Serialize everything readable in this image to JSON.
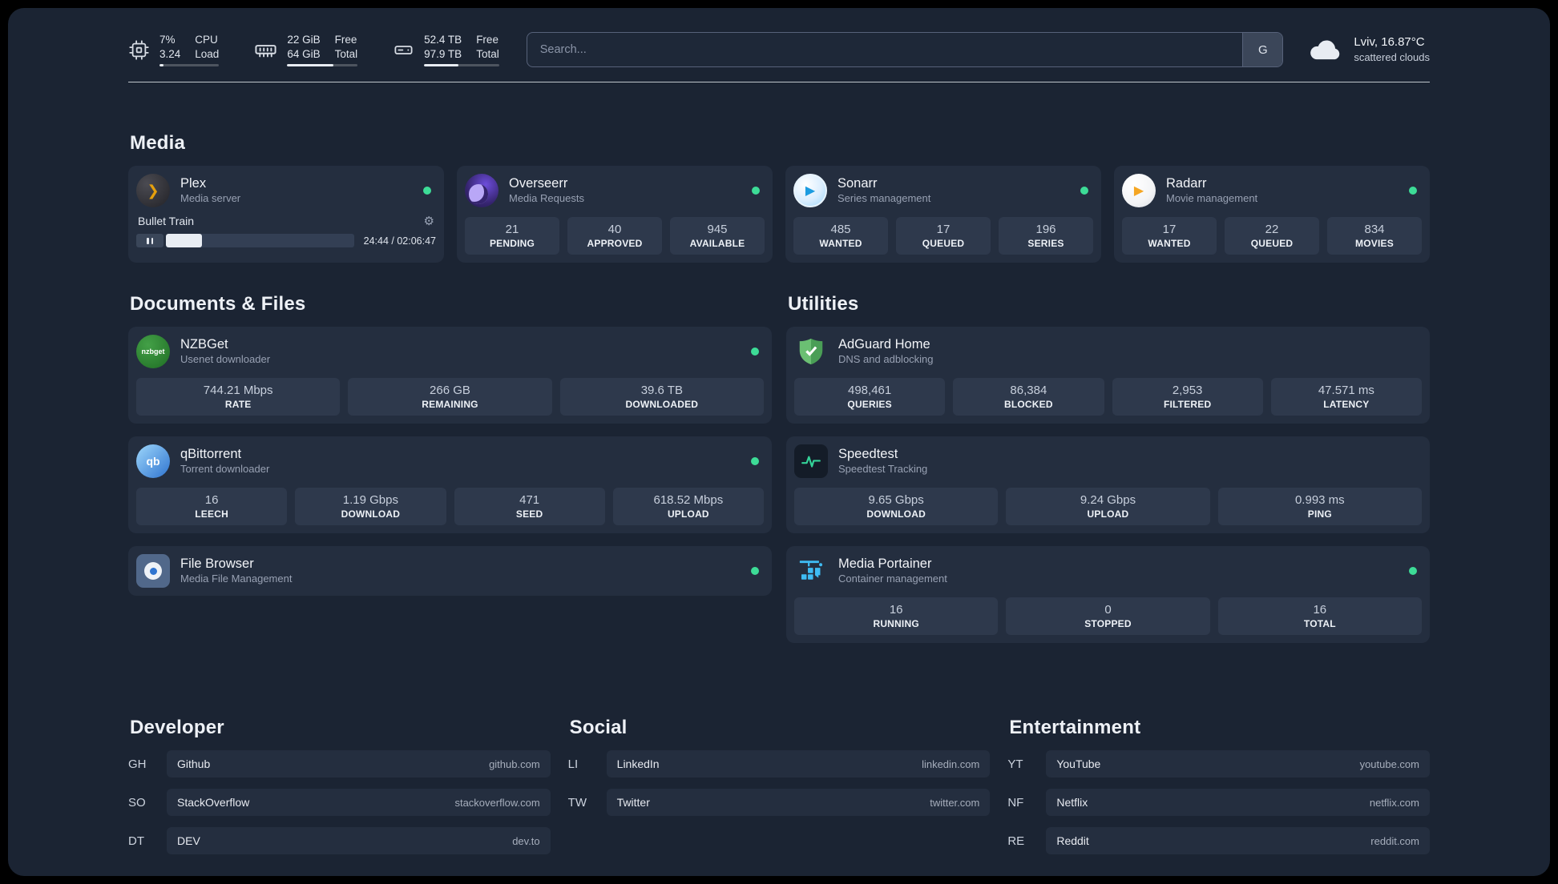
{
  "colors": {
    "page_bg": "#1b2433",
    "card_bg": "#242e3f",
    "tile_bg": "#2e394c",
    "status_green": "#3ddc97"
  },
  "icons": {
    "gear": "⚙",
    "plex_glyph": "❯",
    "sonarr_glyph": "▶",
    "radarr_glyph": "▶",
    "qbittorrent_glyph": "qb",
    "nzbget_text": "nzbget"
  },
  "topbar": {
    "resources": [
      {
        "rows": [
          {
            "value": "7%",
            "label": "CPU"
          },
          {
            "value": "3.24",
            "label": "Load"
          }
        ],
        "progress": 7
      },
      {
        "rows": [
          {
            "value": "22 GiB",
            "label": "Free"
          },
          {
            "value": "64 GiB",
            "label": "Total"
          }
        ],
        "progress": 66
      },
      {
        "rows": [
          {
            "value": "52.4 TB",
            "label": "Free"
          },
          {
            "value": "97.9 TB",
            "label": "Total"
          }
        ],
        "progress": 46
      }
    ],
    "search": {
      "placeholder": "Search...",
      "button_label": "G"
    },
    "weather": {
      "location": "Lviv, 16.87°C",
      "condition": "scattered clouds"
    }
  },
  "sections": {
    "media": "Media",
    "documents": "Documents & Files",
    "utilities": "Utilities",
    "developer": "Developer",
    "social": "Social",
    "entertainment": "Entertainment"
  },
  "services": {
    "plex": {
      "name": "Plex",
      "subtitle": "Media server",
      "player": {
        "track": "Bullet Train",
        "time": "24:44 / 02:06:47",
        "progress": 19
      }
    },
    "overseerr": {
      "name": "Overseerr",
      "subtitle": "Media Requests",
      "stats": [
        {
          "value": "21",
          "label": "PENDING"
        },
        {
          "value": "40",
          "label": "APPROVED"
        },
        {
          "value": "945",
          "label": "AVAILABLE"
        }
      ]
    },
    "sonarr": {
      "name": "Sonarr",
      "subtitle": "Series management",
      "stats": [
        {
          "value": "485",
          "label": "WANTED"
        },
        {
          "value": "17",
          "label": "QUEUED"
        },
        {
          "value": "196",
          "label": "SERIES"
        }
      ]
    },
    "radarr": {
      "name": "Radarr",
      "subtitle": "Movie management",
      "stats": [
        {
          "value": "17",
          "label": "WANTED"
        },
        {
          "value": "22",
          "label": "QUEUED"
        },
        {
          "value": "834",
          "label": "MOVIES"
        }
      ]
    },
    "nzbget": {
      "name": "NZBGet",
      "subtitle": "Usenet downloader",
      "stats": [
        {
          "value": "744.21 Mbps",
          "label": "RATE"
        },
        {
          "value": "266 GB",
          "label": "REMAINING"
        },
        {
          "value": "39.6 TB",
          "label": "DOWNLOADED"
        }
      ]
    },
    "qbittorrent": {
      "name": "qBittorrent",
      "subtitle": "Torrent downloader",
      "stats": [
        {
          "value": "16",
          "label": "LEECH"
        },
        {
          "value": "1.19 Gbps",
          "label": "DOWNLOAD"
        },
        {
          "value": "471",
          "label": "SEED"
        },
        {
          "value": "618.52 Mbps",
          "label": "UPLOAD"
        }
      ]
    },
    "filebrowser": {
      "name": "File Browser",
      "subtitle": "Media File Management"
    },
    "adguard": {
      "name": "AdGuard Home",
      "subtitle": "DNS and adblocking",
      "stats": [
        {
          "value": "498,461",
          "label": "QUERIES"
        },
        {
          "value": "86,384",
          "label": "BLOCKED"
        },
        {
          "value": "2,953",
          "label": "FILTERED"
        },
        {
          "value": "47.571 ms",
          "label": "LATENCY"
        }
      ]
    },
    "speedtest": {
      "name": "Speedtest",
      "subtitle": "Speedtest Tracking",
      "stats": [
        {
          "value": "9.65 Gbps",
          "label": "DOWNLOAD"
        },
        {
          "value": "9.24 Gbps",
          "label": "UPLOAD"
        },
        {
          "value": "0.993 ms",
          "label": "PING"
        }
      ]
    },
    "portainer": {
      "name": "Media Portainer",
      "subtitle": "Container management",
      "stats": [
        {
          "value": "16",
          "label": "RUNNING"
        },
        {
          "value": "0",
          "label": "STOPPED"
        },
        {
          "value": "16",
          "label": "TOTAL"
        }
      ]
    }
  },
  "bookmarks": {
    "developer": [
      {
        "abbr": "GH",
        "name": "Github",
        "domain": "github.com"
      },
      {
        "abbr": "SO",
        "name": "StackOverflow",
        "domain": "stackoverflow.com"
      },
      {
        "abbr": "DT",
        "name": "DEV",
        "domain": "dev.to"
      }
    ],
    "social": [
      {
        "abbr": "LI",
        "name": "LinkedIn",
        "domain": "linkedin.com"
      },
      {
        "abbr": "TW",
        "name": "Twitter",
        "domain": "twitter.com"
      }
    ],
    "entertainment": [
      {
        "abbr": "YT",
        "name": "YouTube",
        "domain": "youtube.com"
      },
      {
        "abbr": "NF",
        "name": "Netflix",
        "domain": "netflix.com"
      },
      {
        "abbr": "RE",
        "name": "Reddit",
        "domain": "reddit.com"
      }
    ]
  }
}
